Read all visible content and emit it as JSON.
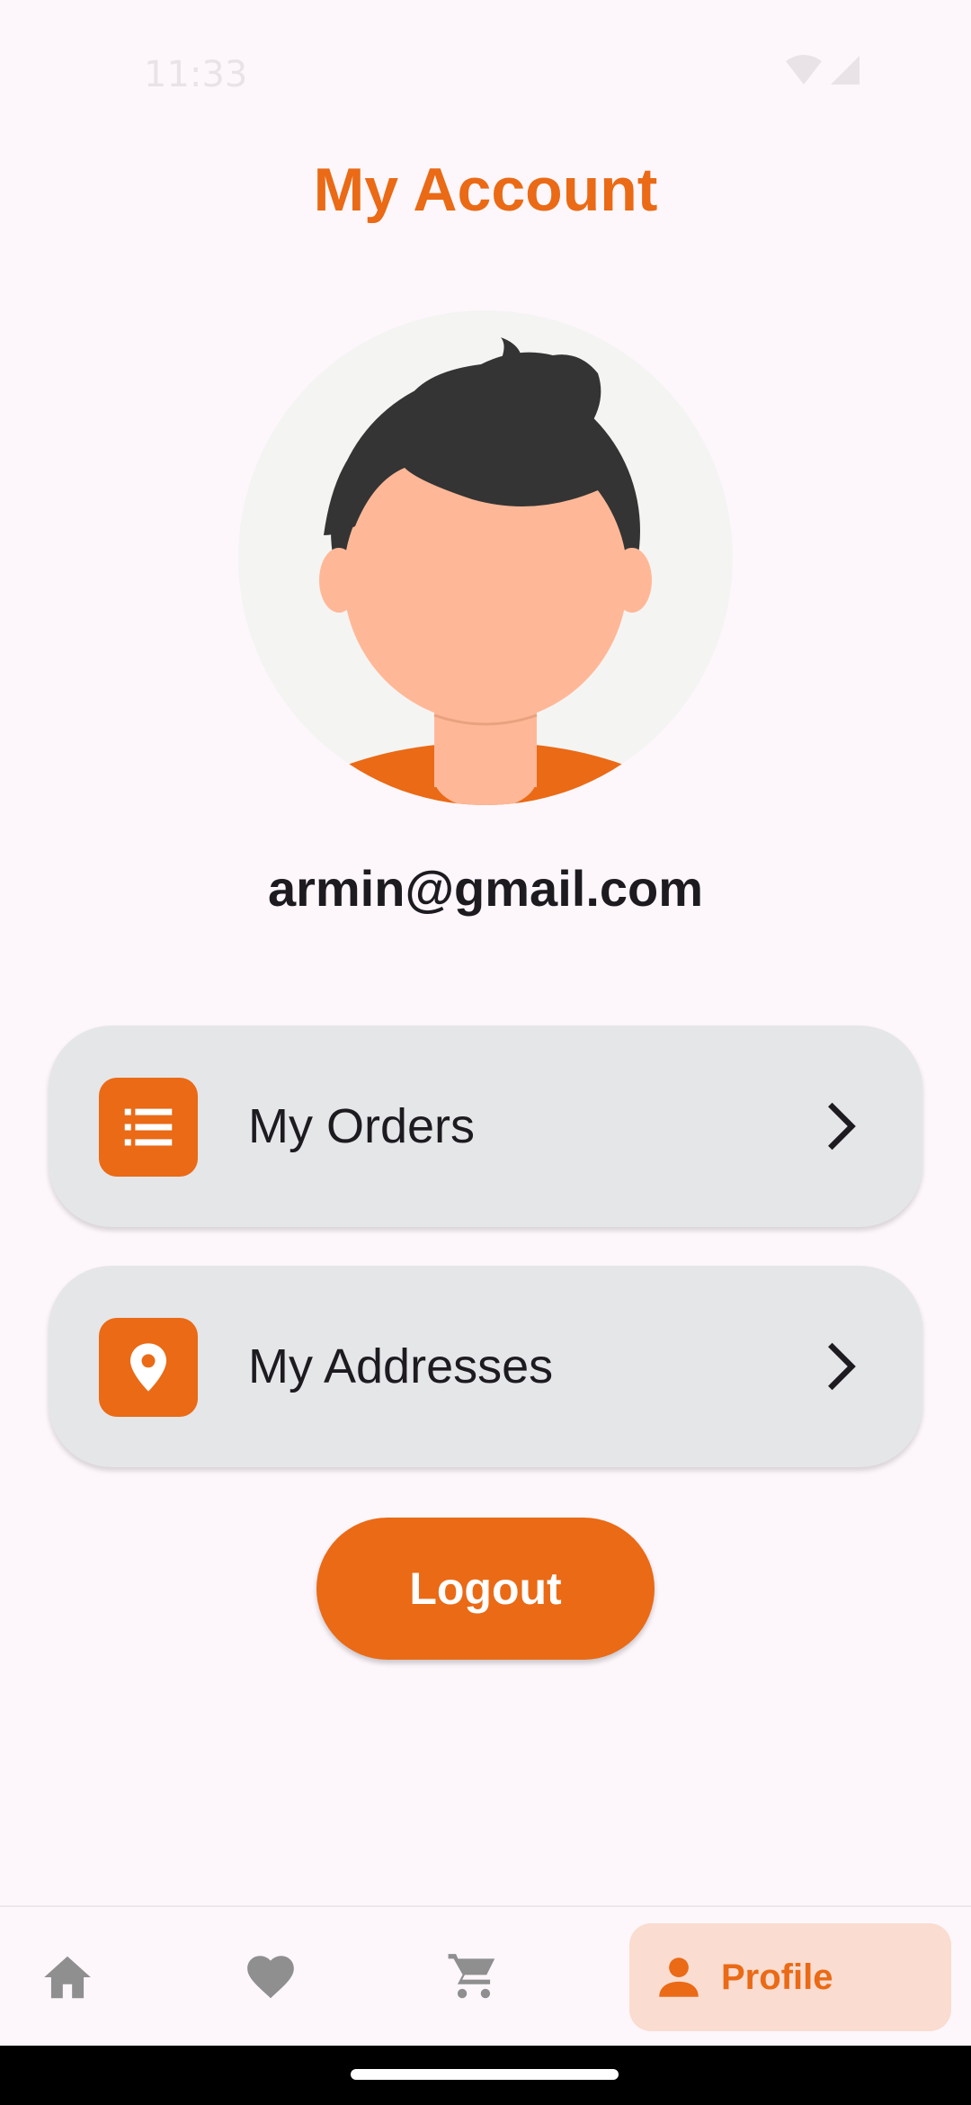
{
  "status_bar": {
    "time": "11:33",
    "icons": [
      "wifi-icon",
      "signal-icon"
    ]
  },
  "header": {
    "title": "My Account"
  },
  "profile": {
    "email": "armin@gmail.com"
  },
  "menu": [
    {
      "label": "My Orders",
      "icon": "list-icon"
    },
    {
      "label": "My Addresses",
      "icon": "location-pin-icon"
    }
  ],
  "logout_label": "Logout",
  "bottom_nav": {
    "items": [
      {
        "icon": "home-icon",
        "label": ""
      },
      {
        "icon": "heart-icon",
        "label": ""
      },
      {
        "icon": "cart-icon",
        "label": ""
      },
      {
        "icon": "person-icon",
        "label": "Profile",
        "selected": true
      }
    ]
  },
  "colors": {
    "accent": "#ea6a16",
    "background": "#fdf7fc",
    "card": "#e5e6e8",
    "nav_selected_bg": "#fadcd0",
    "text": "#1d1b20",
    "icon_inactive": "#8f8f8f"
  }
}
